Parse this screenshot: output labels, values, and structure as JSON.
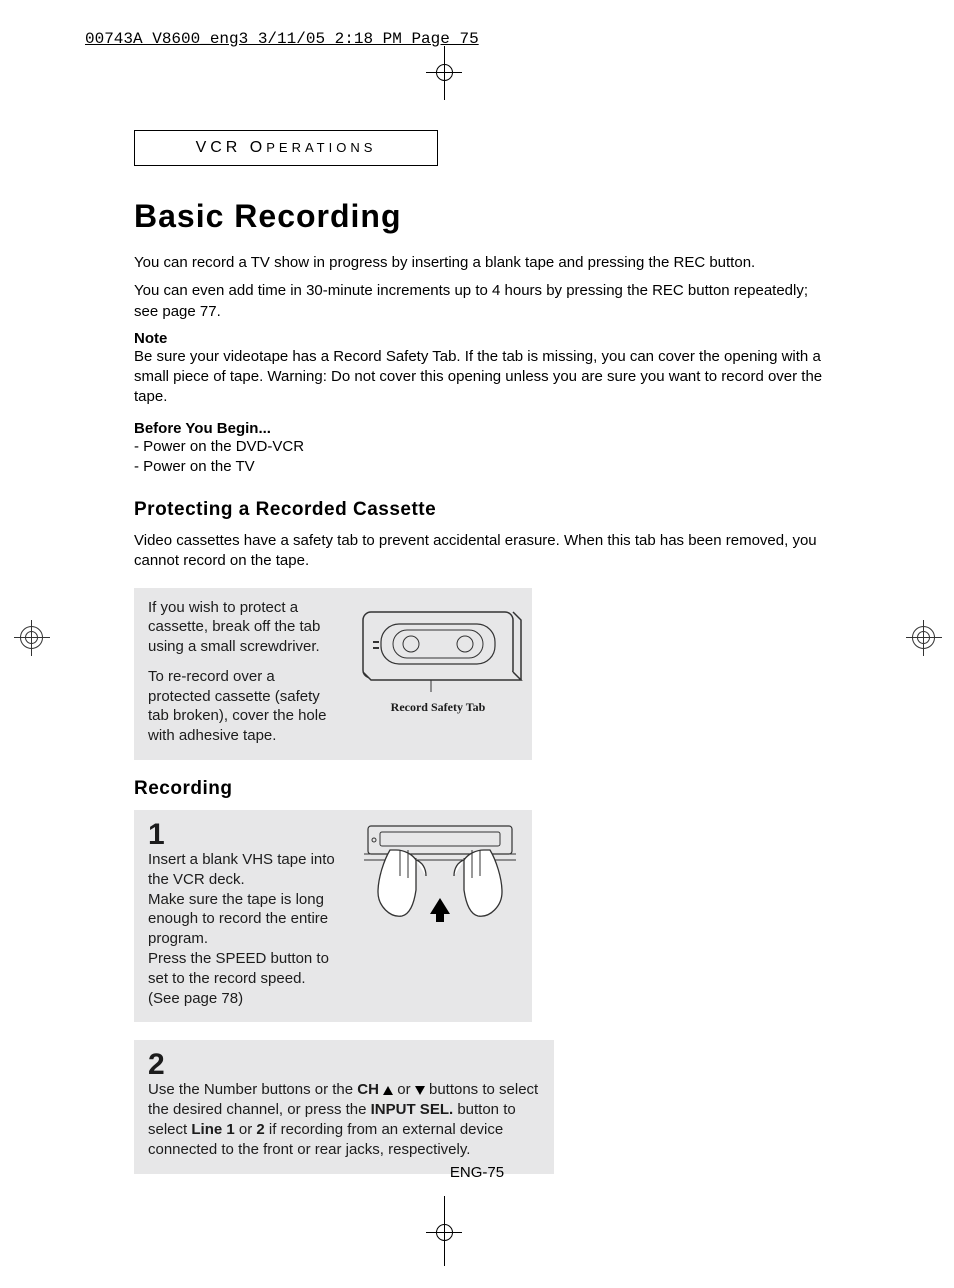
{
  "print_header": "00743A V8600_eng3  3/11/05  2:18 PM  Page 75",
  "section_label": {
    "main": "VCR O",
    "rest": "PERATIONS"
  },
  "title": "Basic Recording",
  "intro_line1": "You can record a TV show in progress by inserting a blank tape and pressing the REC button.",
  "intro_line2": "You can even add time in 30-minute increments up to 4 hours by pressing the REC button repeatedly; see page 77.",
  "note_label": "Note",
  "note_body": "Be sure your videotape has a Record Safety Tab.  If the tab is missing, you can cover the opening with a small piece of tape. Warning: Do not cover this opening unless you are sure you want to record over the tape.",
  "before_label": "Before You Begin...",
  "before_items": [
    "-   Power on the DVD-VCR",
    "-   Power on the TV"
  ],
  "protect_heading": "Protecting a Recorded Cassette",
  "protect_body": "Video cassettes have a safety tab to prevent accidental erasure. When this tab has been removed, you cannot record on the tape.",
  "protect_box_p1": "If you wish to protect a cassette, break off the tab using a small screwdriver.",
  "protect_box_p2": "To re-record over a protected cassette (safety tab broken), cover the hole with adhesive tape.",
  "cassette_caption": "Record Safety Tab",
  "recording_heading": "Recording",
  "step1_num": "1",
  "step1_l1": "Insert a blank VHS tape into the VCR deck.",
  "step1_l2": "Make sure the tape is long enough to record the entire program.",
  "step1_l3": "Press the SPEED button to set to the record speed.",
  "step1_l4": "(See page 78)",
  "step2_num": "2",
  "step2_pre": "Use the Number buttons or the ",
  "step2_ch": "CH",
  "step2_or": " or ",
  "step2_mid": " buttons to select the desired channel, or press the ",
  "step2_input": "INPUT SEL.",
  "step2_after_input": " button to select ",
  "step2_line1": "Line 1",
  "step2_or2": " or ",
  "step2_line2": "2",
  "step2_tail": " if recording from an external device connected to the front or rear jacks, respectively.",
  "page_number": "ENG-75"
}
